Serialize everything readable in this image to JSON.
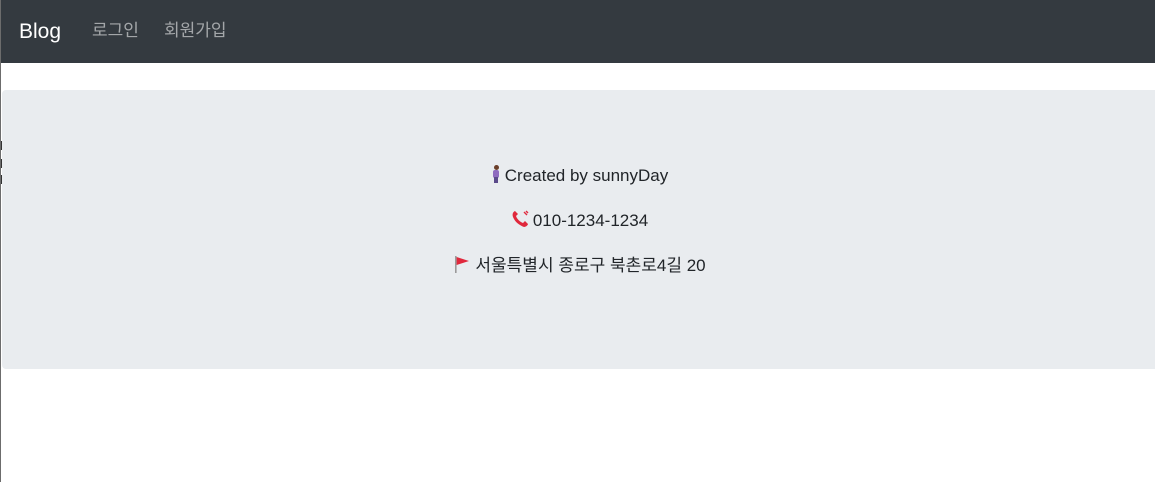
{
  "navbar": {
    "brand": "Blog",
    "links": [
      {
        "label": "로그인"
      },
      {
        "label": "회원가입"
      }
    ]
  },
  "footer": {
    "author": "Created by sunnyDay",
    "phone": "010-1234-1234",
    "address": "서울특별시 종로구 북촌로4길 20"
  },
  "colors": {
    "navbar_bg": "#343a40",
    "jumbotron_bg": "#e9ecef",
    "text": "#212529"
  },
  "icons": {
    "author": "person-icon",
    "phone": "telephone-receiver-icon",
    "address": "red-flag-icon"
  }
}
